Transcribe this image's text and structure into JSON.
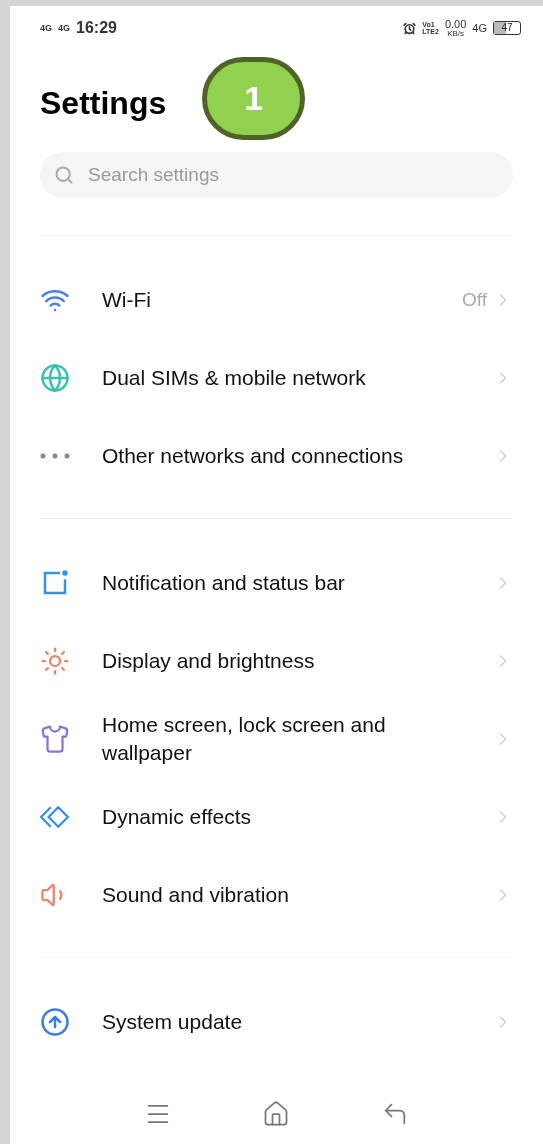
{
  "status_bar": {
    "sim_1": "4G",
    "sim_2": "4G",
    "time": "16:29",
    "volte": "Vo1",
    "lte": "LTE2",
    "data_rate": "0.00",
    "data_unit": "KB/s",
    "network": "4G",
    "battery": "47"
  },
  "callout": {
    "label": "1"
  },
  "title": "Settings",
  "search": {
    "placeholder": "Search settings"
  },
  "sections": [
    {
      "items": [
        {
          "label": "Wi-Fi",
          "value": "Off"
        },
        {
          "label": "Dual SIMs & mobile network"
        },
        {
          "label": "Other networks and connections"
        }
      ]
    },
    {
      "items": [
        {
          "label": "Notification and status bar"
        },
        {
          "label": "Display and brightness"
        },
        {
          "label": "Home screen, lock screen and wallpaper"
        },
        {
          "label": "Dynamic effects"
        },
        {
          "label": "Sound and vibration"
        }
      ]
    },
    {
      "items": [
        {
          "label": "System update"
        }
      ]
    }
  ]
}
